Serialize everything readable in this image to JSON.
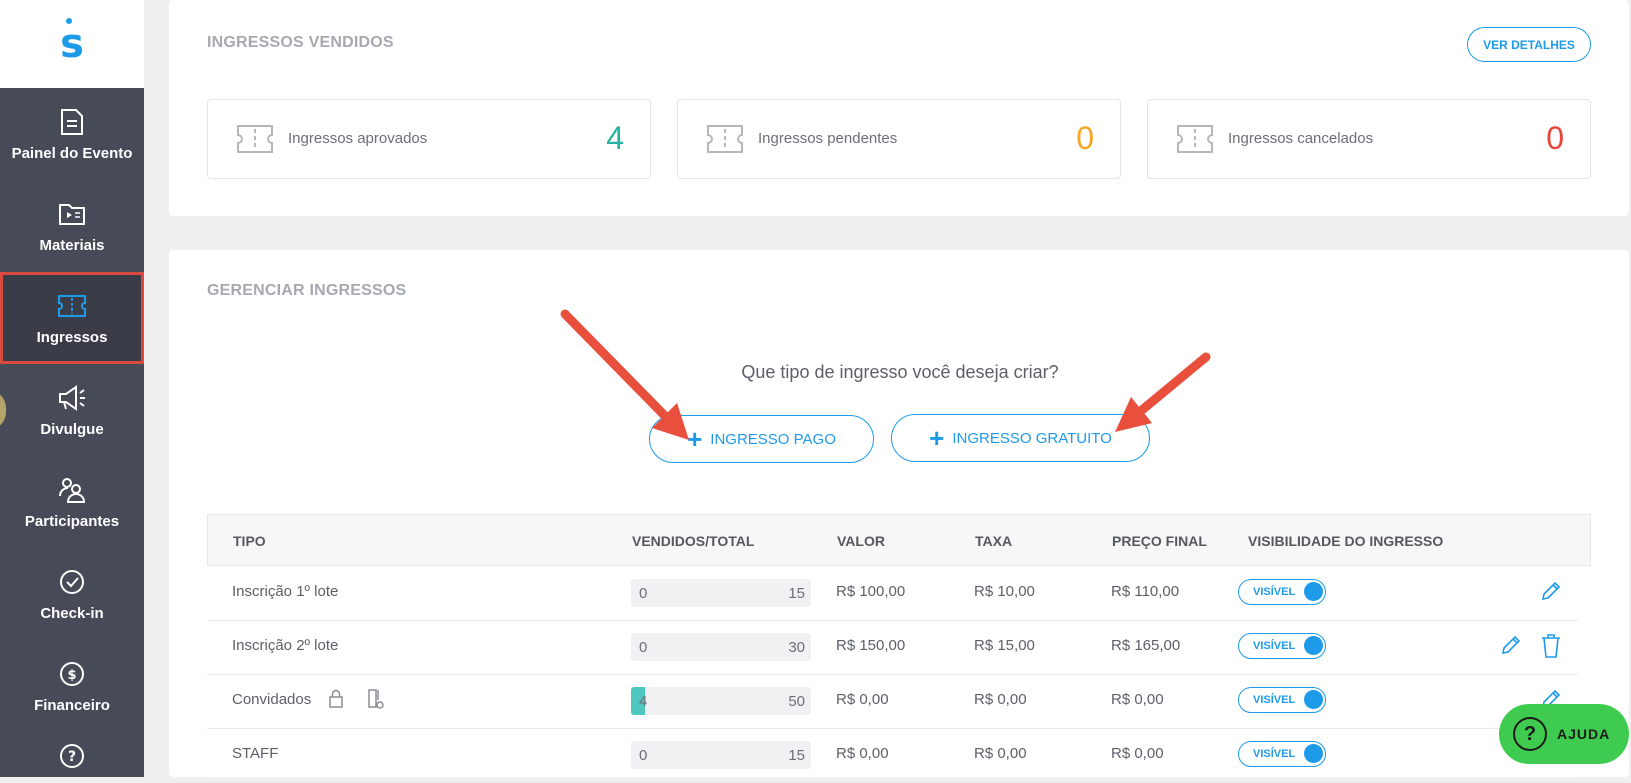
{
  "sidebar": {
    "logo": "s",
    "items": [
      {
        "label": "Painel do Evento",
        "icon": "document-icon"
      },
      {
        "label": "Materiais",
        "icon": "media-folder-icon"
      },
      {
        "label": "Ingressos",
        "icon": "ticket-icon",
        "active": true
      },
      {
        "label": "Divulgue",
        "icon": "megaphone-icon"
      },
      {
        "label": "Participantes",
        "icon": "people-icon"
      },
      {
        "label": "Check-in",
        "icon": "check-circle-icon"
      },
      {
        "label": "Financeiro",
        "icon": "money-circle-icon"
      },
      {
        "label": "",
        "icon": "question-icon"
      }
    ]
  },
  "sold": {
    "title": "INGRESSOS VENDIDOS",
    "details_button": "VER DETALHES",
    "stats": [
      {
        "label": "Ingressos aprovados",
        "value": "4",
        "color": "#26b5a5"
      },
      {
        "label": "Ingressos pendentes",
        "value": "0",
        "color": "#f5a623"
      },
      {
        "label": "Ingressos cancelados",
        "value": "0",
        "color": "#e8453c"
      }
    ]
  },
  "manage": {
    "title": "GERENCIAR INGRESSOS",
    "question": "Que tipo de ingresso você deseja criar?",
    "paid_button": "INGRESSO PAGO",
    "free_button": "INGRESSO GRATUITO",
    "table": {
      "headers": [
        "TIPO",
        "VENDIDOS/TOTAL",
        "VALOR",
        "TAXA",
        "PREÇO FINAL",
        "VISIBILIDADE DO INGRESSO"
      ],
      "rows": [
        {
          "type": "Inscrição 1º lote",
          "sold": "0",
          "total": "15",
          "value": "R$ 100,00",
          "fee": "R$ 10,00",
          "final": "R$ 110,00",
          "visibility": "VISÍVEL",
          "sold_fraction": 0
        },
        {
          "type": "Inscrição 2º lote",
          "sold": "0",
          "total": "30",
          "value": "R$ 150,00",
          "fee": "R$ 15,00",
          "final": "R$ 165,00",
          "visibility": "VISÍVEL",
          "sold_fraction": 0
        },
        {
          "type": "Convidados",
          "sold": "4",
          "total": "50",
          "value": "R$ 0,00",
          "fee": "R$ 0,00",
          "final": "R$ 0,00",
          "visibility": "VISÍVEL",
          "sold_fraction": 0.08
        },
        {
          "type": "STAFF",
          "sold": "0",
          "total": "15",
          "value": "R$ 0,00",
          "fee": "R$ 0,00",
          "final": "R$ 0,00",
          "visibility": "VISÍVEL",
          "sold_fraction": 0
        }
      ]
    }
  },
  "help_button": "AJUDA",
  "colors": {
    "accent": "#1e9be8",
    "sidebar": "#474a57",
    "highlight": "#d94b3f",
    "help": "#3ecb4f"
  }
}
